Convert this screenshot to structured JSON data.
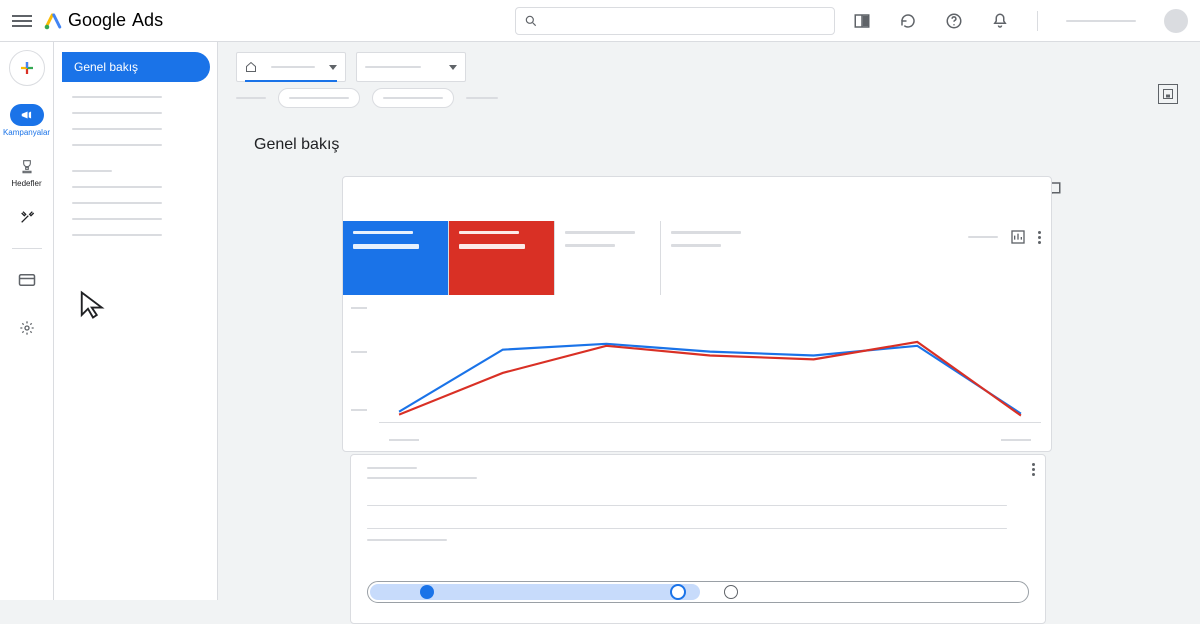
{
  "app": {
    "name_google": "Google",
    "name_ads": "Ads"
  },
  "topbar": {
    "search_placeholder": ""
  },
  "rail": {
    "campaigns_label": "Kampanyalar",
    "goals_label": "Hedefler"
  },
  "side": {
    "overview_label": "Genel bakış"
  },
  "page": {
    "title": "Genel bakış"
  },
  "chart_data": {
    "type": "line",
    "x": [
      0,
      1,
      2,
      3,
      4,
      5,
      6
    ],
    "series": [
      {
        "name": "metric-blue",
        "color": "#1a73e8",
        "values": [
          8,
          72,
          78,
          70,
          66,
          76,
          6
        ]
      },
      {
        "name": "metric-red",
        "color": "#d93025",
        "values": [
          5,
          48,
          76,
          66,
          62,
          80,
          4
        ]
      }
    ],
    "ylim": [
      0,
      100
    ]
  },
  "stepper": {
    "progress_pct": 50,
    "stops_pct": [
      9,
      47,
      55
    ]
  }
}
